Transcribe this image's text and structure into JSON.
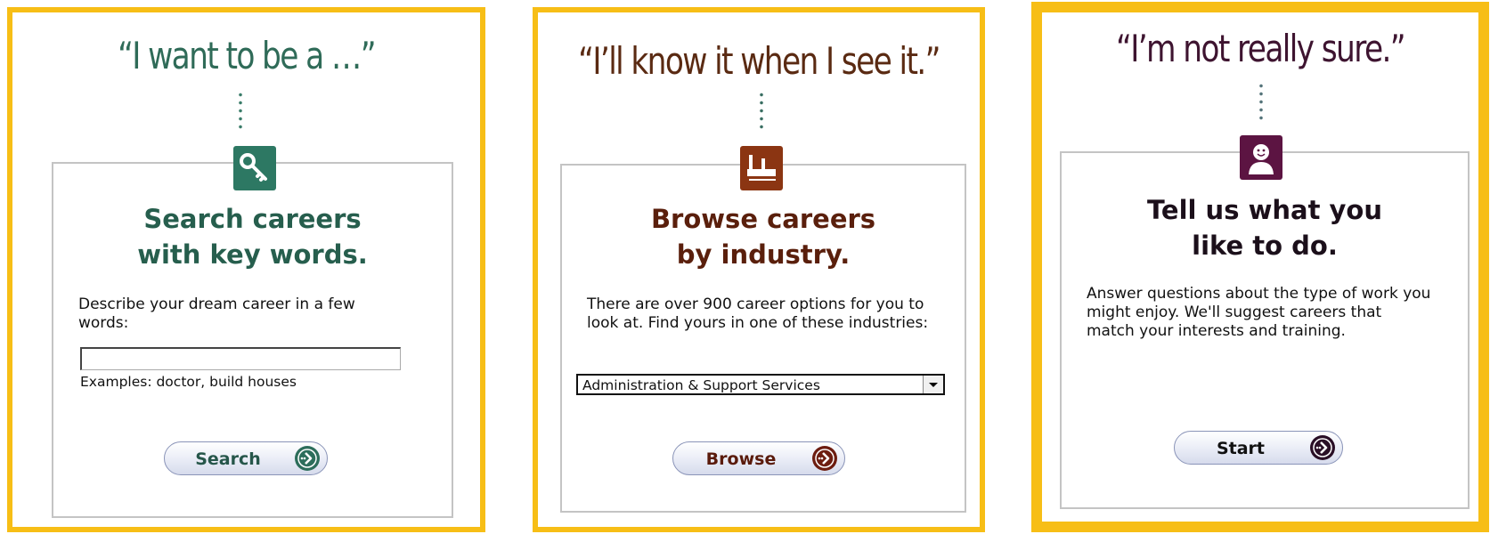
{
  "colors": {
    "frame": "#f7be16",
    "search_accent": "#2d7863",
    "browse_accent": "#8b3512",
    "start_accent": "#5c1442"
  },
  "panels": [
    {
      "quote": "“I want to be a …”",
      "icon": "key-icon",
      "heading_line1": "Search careers",
      "heading_line2": "with key words.",
      "description": "Describe your dream career in a few words:",
      "input_value": "",
      "examples": "Examples: doctor, build houses",
      "button_label": "Search"
    },
    {
      "quote": "“I’ll know it when I see it.”",
      "icon": "factory-icon",
      "heading_line1": "Browse careers",
      "heading_line2": "by industry.",
      "description": "There are over 900 career options for you to look at. Find yours in one of these industries:",
      "select_value": "Administration & Support Services",
      "button_label": "Browse"
    },
    {
      "quote": "“I’m not really sure.”",
      "icon": "person-icon",
      "heading_line1": "Tell us what you",
      "heading_line2": "like to do.",
      "description": "Answer questions about the type of work you might enjoy. We'll suggest careers that match your interests and training.",
      "button_label": "Start"
    }
  ]
}
